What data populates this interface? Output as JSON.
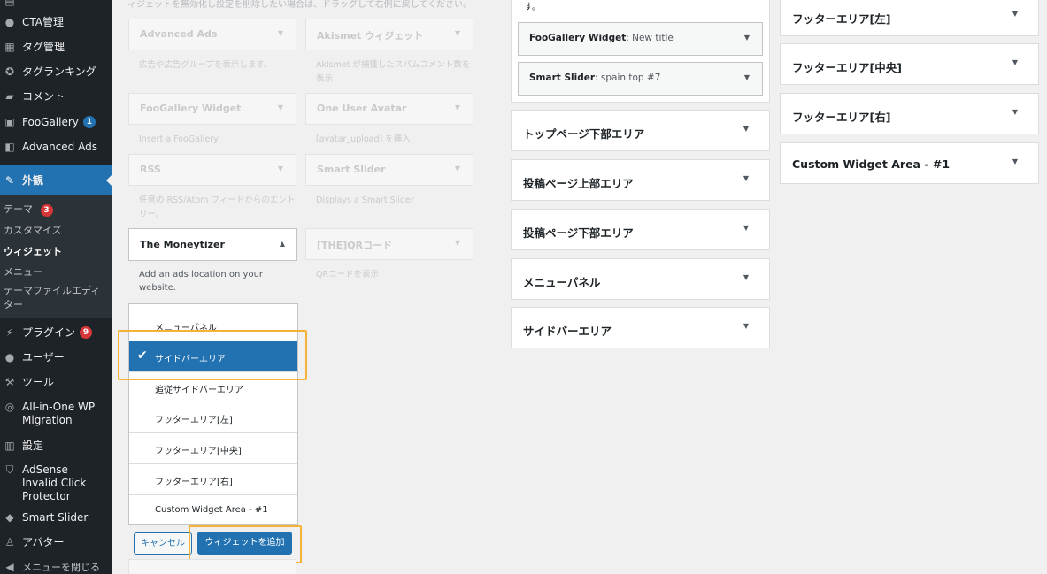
{
  "sidebar": {
    "items": [
      {
        "label": "CTA管理",
        "icon": "lightbulb-icon"
      },
      {
        "label": "タグ管理",
        "icon": "table-icon"
      },
      {
        "label": "タグランキング",
        "icon": "award-icon"
      },
      {
        "label": "コメント",
        "icon": "comment-icon"
      },
      {
        "label": "FooGallery",
        "icon": "gallery-icon",
        "badge": "1"
      },
      {
        "label": "Advanced Ads",
        "icon": "ads-icon"
      },
      {
        "label": "外観",
        "icon": "brush-icon"
      },
      {
        "label": "プラグイン",
        "icon": "plugin-icon",
        "badge": "9"
      },
      {
        "label": "ユーザー",
        "icon": "user-icon"
      },
      {
        "label": "ツール",
        "icon": "wrench-icon"
      },
      {
        "label": "All-in-One WP Migration",
        "icon": "migration-icon"
      },
      {
        "label": "設定",
        "icon": "settings-icon"
      },
      {
        "label": "AdSense Invalid Click Protector",
        "icon": "shield-icon"
      },
      {
        "label": "Smart Slider",
        "icon": "slider-icon"
      },
      {
        "label": "アバター",
        "icon": "avatar-icon"
      },
      {
        "label": "メニューを閉じる",
        "icon": "collapse-icon"
      }
    ],
    "submenu": [
      {
        "label": "テーマ",
        "badge": "3"
      },
      {
        "label": "カスタマイズ"
      },
      {
        "label": "ウィジェット",
        "current": true
      },
      {
        "label": "メニュー"
      },
      {
        "label": "テーマファイルエディター"
      }
    ]
  },
  "available": {
    "intro": "ィジェットを無効化し設定を削除したい場合は、ドラッグして右側に戻してください。",
    "widgets": [
      {
        "title": "Advanced Ads",
        "desc": "広告や広告グループを表示します。"
      },
      {
        "title": "Akismet ウィジェット",
        "desc": "Akismet が捕獲したスパムコメント数を表示"
      },
      {
        "title": "FooGallery Widget",
        "desc": "Insert a FooGallery"
      },
      {
        "title": "One User Avatar",
        "desc": "[avatar_upload] を挿入"
      },
      {
        "title": "RSS",
        "desc": "任意の RSS/Atom フィードからのエントリー。"
      },
      {
        "title": "Smart Slider",
        "desc": "Displays a Smart Slider"
      },
      {
        "title": "[THE]QRコード",
        "desc": "QRコードを表示"
      }
    ],
    "moneytizer": {
      "title": "The Moneytizer",
      "desc": "Add an ads location on your website.",
      "areas": [
        "メニューパネル",
        "サイドバーエリア",
        "追従サイドバーエリア",
        "フッターエリア[左]",
        "フッターエリア[中央]",
        "フッターエリア[右]",
        "Custom Widget Area - #1"
      ],
      "selected": "サイドバーエリア",
      "cancel_label": "キャンセル",
      "add_label": "ウィジェットを追加"
    }
  },
  "areas": {
    "top_text": "す。",
    "inner_widgets": [
      {
        "title": "FooGallery Widget",
        "sub": ": New title"
      },
      {
        "title": "Smart Slider",
        "sub": ": spain top #7"
      }
    ],
    "middle": [
      "トップページ下部エリア",
      "投稿ページ上部エリア",
      "投稿ページ下部エリア",
      "メニューパネル",
      "サイドバーエリア"
    ],
    "right": [
      "フッターエリア[左]",
      "フッターエリア[中央]",
      "フッターエリア[右]",
      "Custom Widget Area - #1"
    ]
  },
  "colors": {
    "accent": "#2271b1",
    "highlight": "#f5b335",
    "sidebar": "#1d2327"
  }
}
